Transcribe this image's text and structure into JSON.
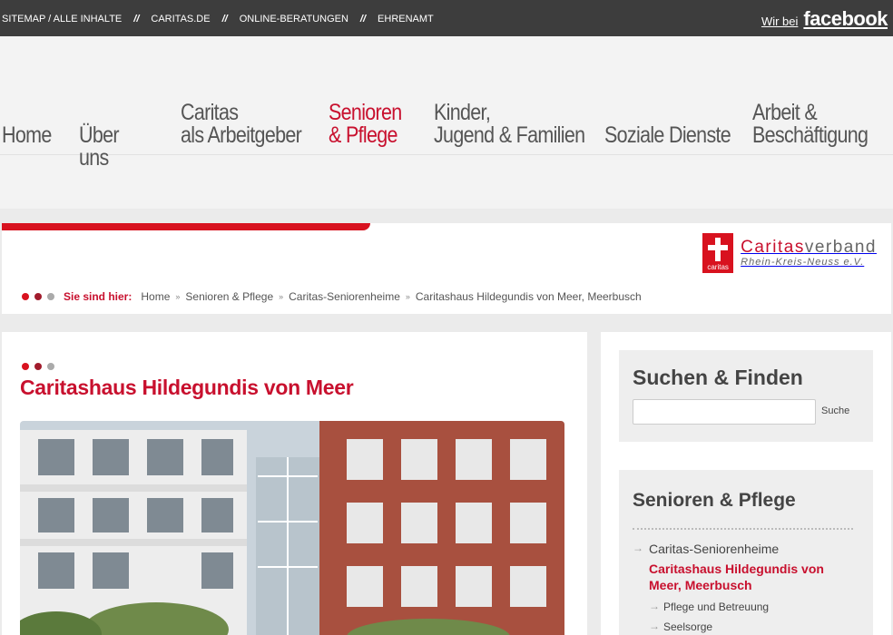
{
  "topbar": {
    "links": [
      "SITEMAP / ALLE INHALTE",
      "CARITAS.DE",
      "ONLINE-BERATUNGEN",
      "EHRENAMT"
    ],
    "separator": "//",
    "facebook_prefix": "Wir bei",
    "facebook_brand": "facebook"
  },
  "mainnav": {
    "items": [
      {
        "line1": "Home",
        "line2": ""
      },
      {
        "line1": "Über",
        "line2": "uns"
      },
      {
        "line1": "Caritas",
        "line2": "als Arbeitgeber"
      },
      {
        "line1": "Senioren",
        "line2": "& Pflege"
      },
      {
        "line1": "Kinder,",
        "line2": "Jugend & Familien"
      },
      {
        "line1": "Soziale Dienste",
        "line2": ""
      },
      {
        "line1": "Arbeit &",
        "line2": "Beschäftigung"
      }
    ],
    "active_index": 3
  },
  "logo": {
    "badge_text": "caritas",
    "name_red": "Caritas",
    "name_grey": "verband",
    "subline": "Rhein-Kreis-Neuss e.V."
  },
  "breadcrumb": {
    "label": "Sie sind hier:",
    "items": [
      "Home",
      "Senioren & Pflege",
      "Caritas-Seniorenheime",
      "Caritashaus Hildegundis von Meer, Meerbusch"
    ],
    "separator": "»"
  },
  "content": {
    "title": "Caritashaus Hildegundis von Meer"
  },
  "search": {
    "title": "Suchen & Finden",
    "value": "",
    "button": "Suche"
  },
  "sidenav": {
    "title": "Senioren & Pflege",
    "items": [
      {
        "label": "Caritas-Seniorenheime"
      },
      {
        "label": "Caritashaus Hildegundis von Meer, Meerbusch"
      },
      {
        "label": "Pflege und Betreuung"
      },
      {
        "label": "Seelsorge"
      }
    ]
  },
  "colors": {
    "accent": "#c8102e",
    "topbar": "#3d3d3d",
    "background": "#ebebeb"
  }
}
